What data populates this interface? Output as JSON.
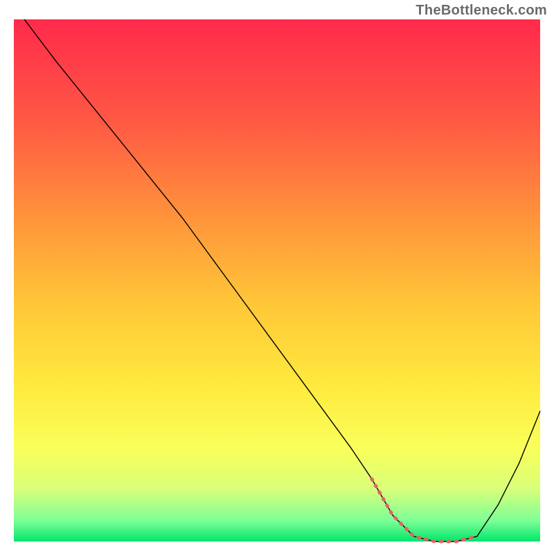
{
  "watermark": "TheBottleneck.com",
  "chart_data": {
    "type": "line",
    "title": "",
    "xlabel": "",
    "ylabel": "",
    "xlim": [
      0,
      100
    ],
    "ylim": [
      0,
      100
    ],
    "grid": false,
    "legend": false,
    "notes": "No axis ticks or labels are rendered. Values estimated from pixel position on a 0–100 normalized scale.",
    "background_gradient": {
      "stops": [
        {
          "offset": 0,
          "color": "#ff2a4b"
        },
        {
          "offset": 20,
          "color": "#ff5a44"
        },
        {
          "offset": 40,
          "color": "#ff9a3a"
        },
        {
          "offset": 55,
          "color": "#ffc838"
        },
        {
          "offset": 70,
          "color": "#ffe93e"
        },
        {
          "offset": 82,
          "color": "#faff59"
        },
        {
          "offset": 90,
          "color": "#d8ff7a"
        },
        {
          "offset": 96,
          "color": "#7dff97"
        },
        {
          "offset": 100,
          "color": "#00e66b"
        }
      ]
    },
    "series": [
      {
        "name": "bottleneck-curve",
        "color": "#000000",
        "stroke_width": 1.4,
        "x": [
          2,
          8,
          16,
          24,
          32,
          40,
          48,
          56,
          64,
          68,
          72,
          76,
          80,
          84,
          88,
          92,
          96,
          100
        ],
        "y": [
          100,
          92,
          82,
          72,
          62,
          51,
          40,
          29,
          18,
          12,
          5,
          1,
          0,
          0,
          1,
          7,
          15,
          25
        ]
      },
      {
        "name": "optimal-range-highlight",
        "color": "#e06666",
        "stroke_width": 5,
        "x": [
          68,
          72,
          76,
          80,
          84,
          88
        ],
        "y": [
          12,
          5,
          1,
          0,
          0,
          1
        ]
      }
    ]
  }
}
